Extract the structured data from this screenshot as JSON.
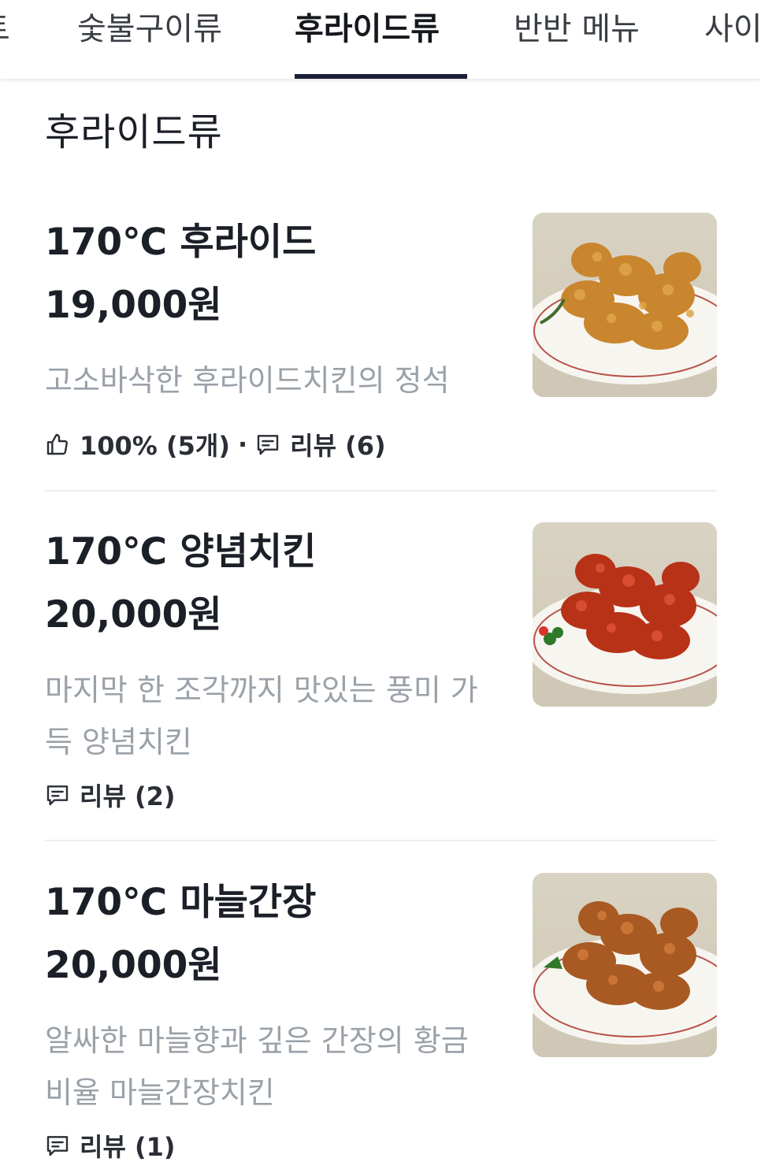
{
  "tabs": [
    {
      "label": "트",
      "active": false
    },
    {
      "label": "숯불구이류",
      "active": false
    },
    {
      "label": "후라이드류",
      "active": true
    },
    {
      "label": "반반 메뉴",
      "active": false
    },
    {
      "label": "사이",
      "active": false
    }
  ],
  "section": {
    "title": "후라이드류"
  },
  "items": [
    {
      "name": "170℃ 후라이드",
      "price": "19,000원",
      "description": "고소바삭한 후라이드치킨의 정석",
      "like_icon": "thumbs-up-icon",
      "like_text": "100% (5개)",
      "separator": "·",
      "review_icon": "comment-icon",
      "review_text": "리뷰 (6)",
      "image_icon": "fried-chicken-plate"
    },
    {
      "name": "170℃ 양념치킨",
      "price": "20,000원",
      "description": "마지막 한 조각까지 맛있는 풍미 가득 양념치킨",
      "review_icon": "comment-icon",
      "review_text": "리뷰 (2)",
      "image_icon": "seasoned-chicken-plate"
    },
    {
      "name": "170℃ 마늘간장",
      "price": "20,000원",
      "description": "알싸한 마늘향과 깊은 간장의 황금비율 마늘간장치킨",
      "review_icon": "comment-icon",
      "review_text": "리뷰 (1)",
      "image_icon": "garlic-soy-chicken-plate"
    }
  ],
  "colors": {
    "active_tab_underline": "#1b2036",
    "description_text": "#9aa1a8",
    "divider": "#eceef1"
  }
}
